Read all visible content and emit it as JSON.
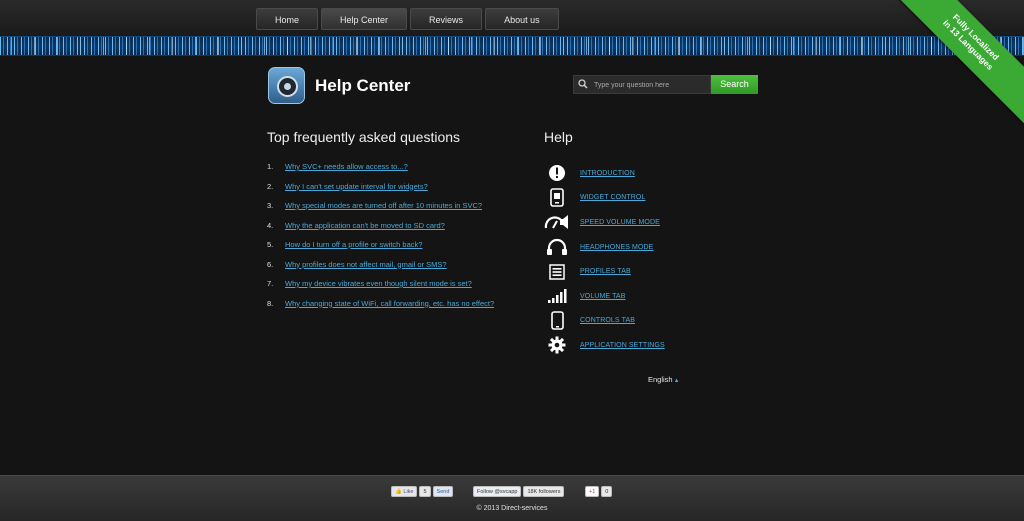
{
  "nav": {
    "items": [
      {
        "label": "Home"
      },
      {
        "label": "Help Center"
      },
      {
        "label": "Reviews"
      },
      {
        "label": "About us"
      }
    ]
  },
  "ribbon": {
    "line1": "Fully Localized",
    "line2": "in 13 Languages"
  },
  "header": {
    "title": "Help Center",
    "search_placeholder": "Type your question here",
    "search_button": "Search"
  },
  "faq": {
    "title": "Top frequently asked questions",
    "items": [
      {
        "num": "1.",
        "text": "Why SVC+ needs allow access to...?"
      },
      {
        "num": "2.",
        "text": "Why I can't set update interval for widgets?"
      },
      {
        "num": "3.",
        "text": "Why special modes are turned off after 10 minutes in SVC?"
      },
      {
        "num": "4.",
        "text": "Why the application can't be moved to SD card?"
      },
      {
        "num": "5.",
        "text": "How do I turn off a profile or switch back?"
      },
      {
        "num": "6.",
        "text": "Why profiles does not affect mail, gmail or SMS?"
      },
      {
        "num": "7.",
        "text": "Why my device vibrates even though silent mode is set?"
      },
      {
        "num": "8.",
        "text": "Why changing state of WiFi, call forwarding, etc. has no effect?"
      }
    ]
  },
  "help": {
    "title": "Help",
    "items": [
      {
        "label": "INTRODUCTION",
        "icon": "exclamation-icon"
      },
      {
        "label": "WIDGET CONTROL",
        "icon": "widget-icon"
      },
      {
        "label": "SPEED VOLUME MODE",
        "icon": "speed-icon"
      },
      {
        "label": "HEADPHONES MODE",
        "icon": "headphones-icon"
      },
      {
        "label": "PROFILES TAB",
        "icon": "profiles-icon"
      },
      {
        "label": "VOLUME TAB",
        "icon": "volume-icon"
      },
      {
        "label": "CONTROLS TAB",
        "icon": "phone-icon"
      },
      {
        "label": "APPLICATION SETTINGS",
        "icon": "gear-icon"
      }
    ]
  },
  "language": {
    "label": "English",
    "arrow": "▲"
  },
  "footer": {
    "like_label": "Like",
    "like_count": "5",
    "send_label": "Send",
    "follow_label": "Follow @svcapp",
    "followers": "18K followers",
    "gplus_label": "+1",
    "gplus_count": "0",
    "copyright": "© 2013 Direct-services"
  },
  "colors": {
    "link": "#4aa8d8",
    "accent_green": "#3aaa35",
    "background": "#141414"
  }
}
